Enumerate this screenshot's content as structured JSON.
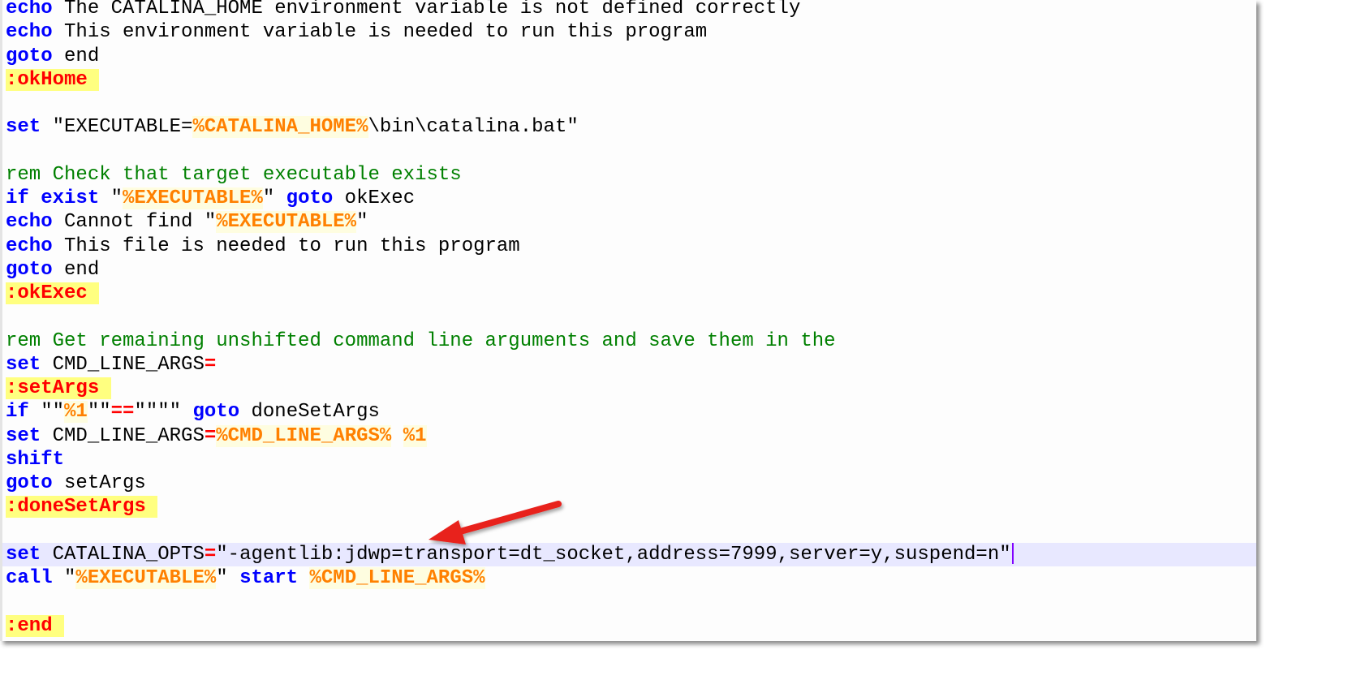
{
  "editor": {
    "lines": [
      [
        {
          "t": "kw",
          "v": "echo"
        },
        {
          "t": "txt",
          "v": " The CATALINA_HOME environment variable is not defined correctly"
        }
      ],
      [
        {
          "t": "kw",
          "v": "echo"
        },
        {
          "t": "txt",
          "v": " This environment variable is needed to run this program"
        }
      ],
      [
        {
          "t": "kw",
          "v": "goto"
        },
        {
          "t": "txt",
          "v": " end"
        }
      ],
      [
        {
          "t": "label",
          "v": ":okHome "
        }
      ],
      [],
      [
        {
          "t": "kw",
          "v": "set"
        },
        {
          "t": "txt",
          "v": " \"EXECUTABLE="
        },
        {
          "t": "var",
          "v": "%CATALINA_HOME%"
        },
        {
          "t": "txt",
          "v": "\\bin\\catalina.bat\""
        }
      ],
      [],
      [
        {
          "t": "comment",
          "v": "rem Check that target executable exists"
        }
      ],
      [
        {
          "t": "kw",
          "v": "if exist"
        },
        {
          "t": "txt",
          "v": " \""
        },
        {
          "t": "var",
          "v": "%EXECUTABLE%"
        },
        {
          "t": "txt",
          "v": "\" "
        },
        {
          "t": "kw",
          "v": "goto"
        },
        {
          "t": "txt",
          "v": " okExec"
        }
      ],
      [
        {
          "t": "kw",
          "v": "echo"
        },
        {
          "t": "txt",
          "v": " Cannot find \""
        },
        {
          "t": "var",
          "v": "%EXECUTABLE%"
        },
        {
          "t": "txt",
          "v": "\""
        }
      ],
      [
        {
          "t": "kw",
          "v": "echo"
        },
        {
          "t": "txt",
          "v": " This file is needed to run this program"
        }
      ],
      [
        {
          "t": "kw",
          "v": "goto"
        },
        {
          "t": "txt",
          "v": " end"
        }
      ],
      [
        {
          "t": "label",
          "v": ":okExec "
        }
      ],
      [],
      [
        {
          "t": "comment",
          "v": "rem Get remaining unshifted command line arguments and save them in the"
        }
      ],
      [
        {
          "t": "kw",
          "v": "set"
        },
        {
          "t": "txt",
          "v": " CMD_LINE_ARGS"
        },
        {
          "t": "op",
          "v": "="
        }
      ],
      [
        {
          "t": "label",
          "v": ":setArgs "
        }
      ],
      [
        {
          "t": "kw",
          "v": "if"
        },
        {
          "t": "txt",
          "v": " \"\""
        },
        {
          "t": "var",
          "v": "%1"
        },
        {
          "t": "txt",
          "v": "\"\""
        },
        {
          "t": "op",
          "v": "=="
        },
        {
          "t": "txt",
          "v": "\"\"\"\" "
        },
        {
          "t": "kw",
          "v": "goto"
        },
        {
          "t": "txt",
          "v": " doneSetArgs"
        }
      ],
      [
        {
          "t": "kw",
          "v": "set"
        },
        {
          "t": "txt",
          "v": " CMD_LINE_ARGS"
        },
        {
          "t": "op",
          "v": "="
        },
        {
          "t": "var",
          "v": "%CMD_LINE_ARGS%"
        },
        {
          "t": "txt",
          "v": " "
        },
        {
          "t": "var",
          "v": "%1"
        }
      ],
      [
        {
          "t": "kw",
          "v": "shift"
        }
      ],
      [
        {
          "t": "kw",
          "v": "goto"
        },
        {
          "t": "txt",
          "v": " setArgs"
        }
      ],
      [
        {
          "t": "label",
          "v": ":doneSetArgs "
        }
      ],
      [],
      [
        {
          "t": "kw",
          "v": "set"
        },
        {
          "t": "txt",
          "v": " CATALINA_OPTS"
        },
        {
          "t": "op",
          "v": "="
        },
        {
          "t": "txt",
          "v": "\"-agentlib:jdwp=transport=dt_socket,address=7999,server=y,suspend=n\""
        },
        {
          "t": "caret",
          "v": ""
        }
      ],
      [
        {
          "t": "kw",
          "v": "call"
        },
        {
          "t": "txt",
          "v": " \""
        },
        {
          "t": "var",
          "v": "%EXECUTABLE%"
        },
        {
          "t": "txt",
          "v": "\" "
        },
        {
          "t": "kw",
          "v": "start"
        },
        {
          "t": "txt",
          "v": " "
        },
        {
          "t": "var",
          "v": "%CMD_LINE_ARGS%"
        }
      ],
      [],
      [
        {
          "t": "label",
          "v": ":end "
        }
      ]
    ],
    "current_line_index": 23
  },
  "annotation": {
    "type": "arrow",
    "color": "#e8201f",
    "points_to": "jdwp agentlib option"
  }
}
